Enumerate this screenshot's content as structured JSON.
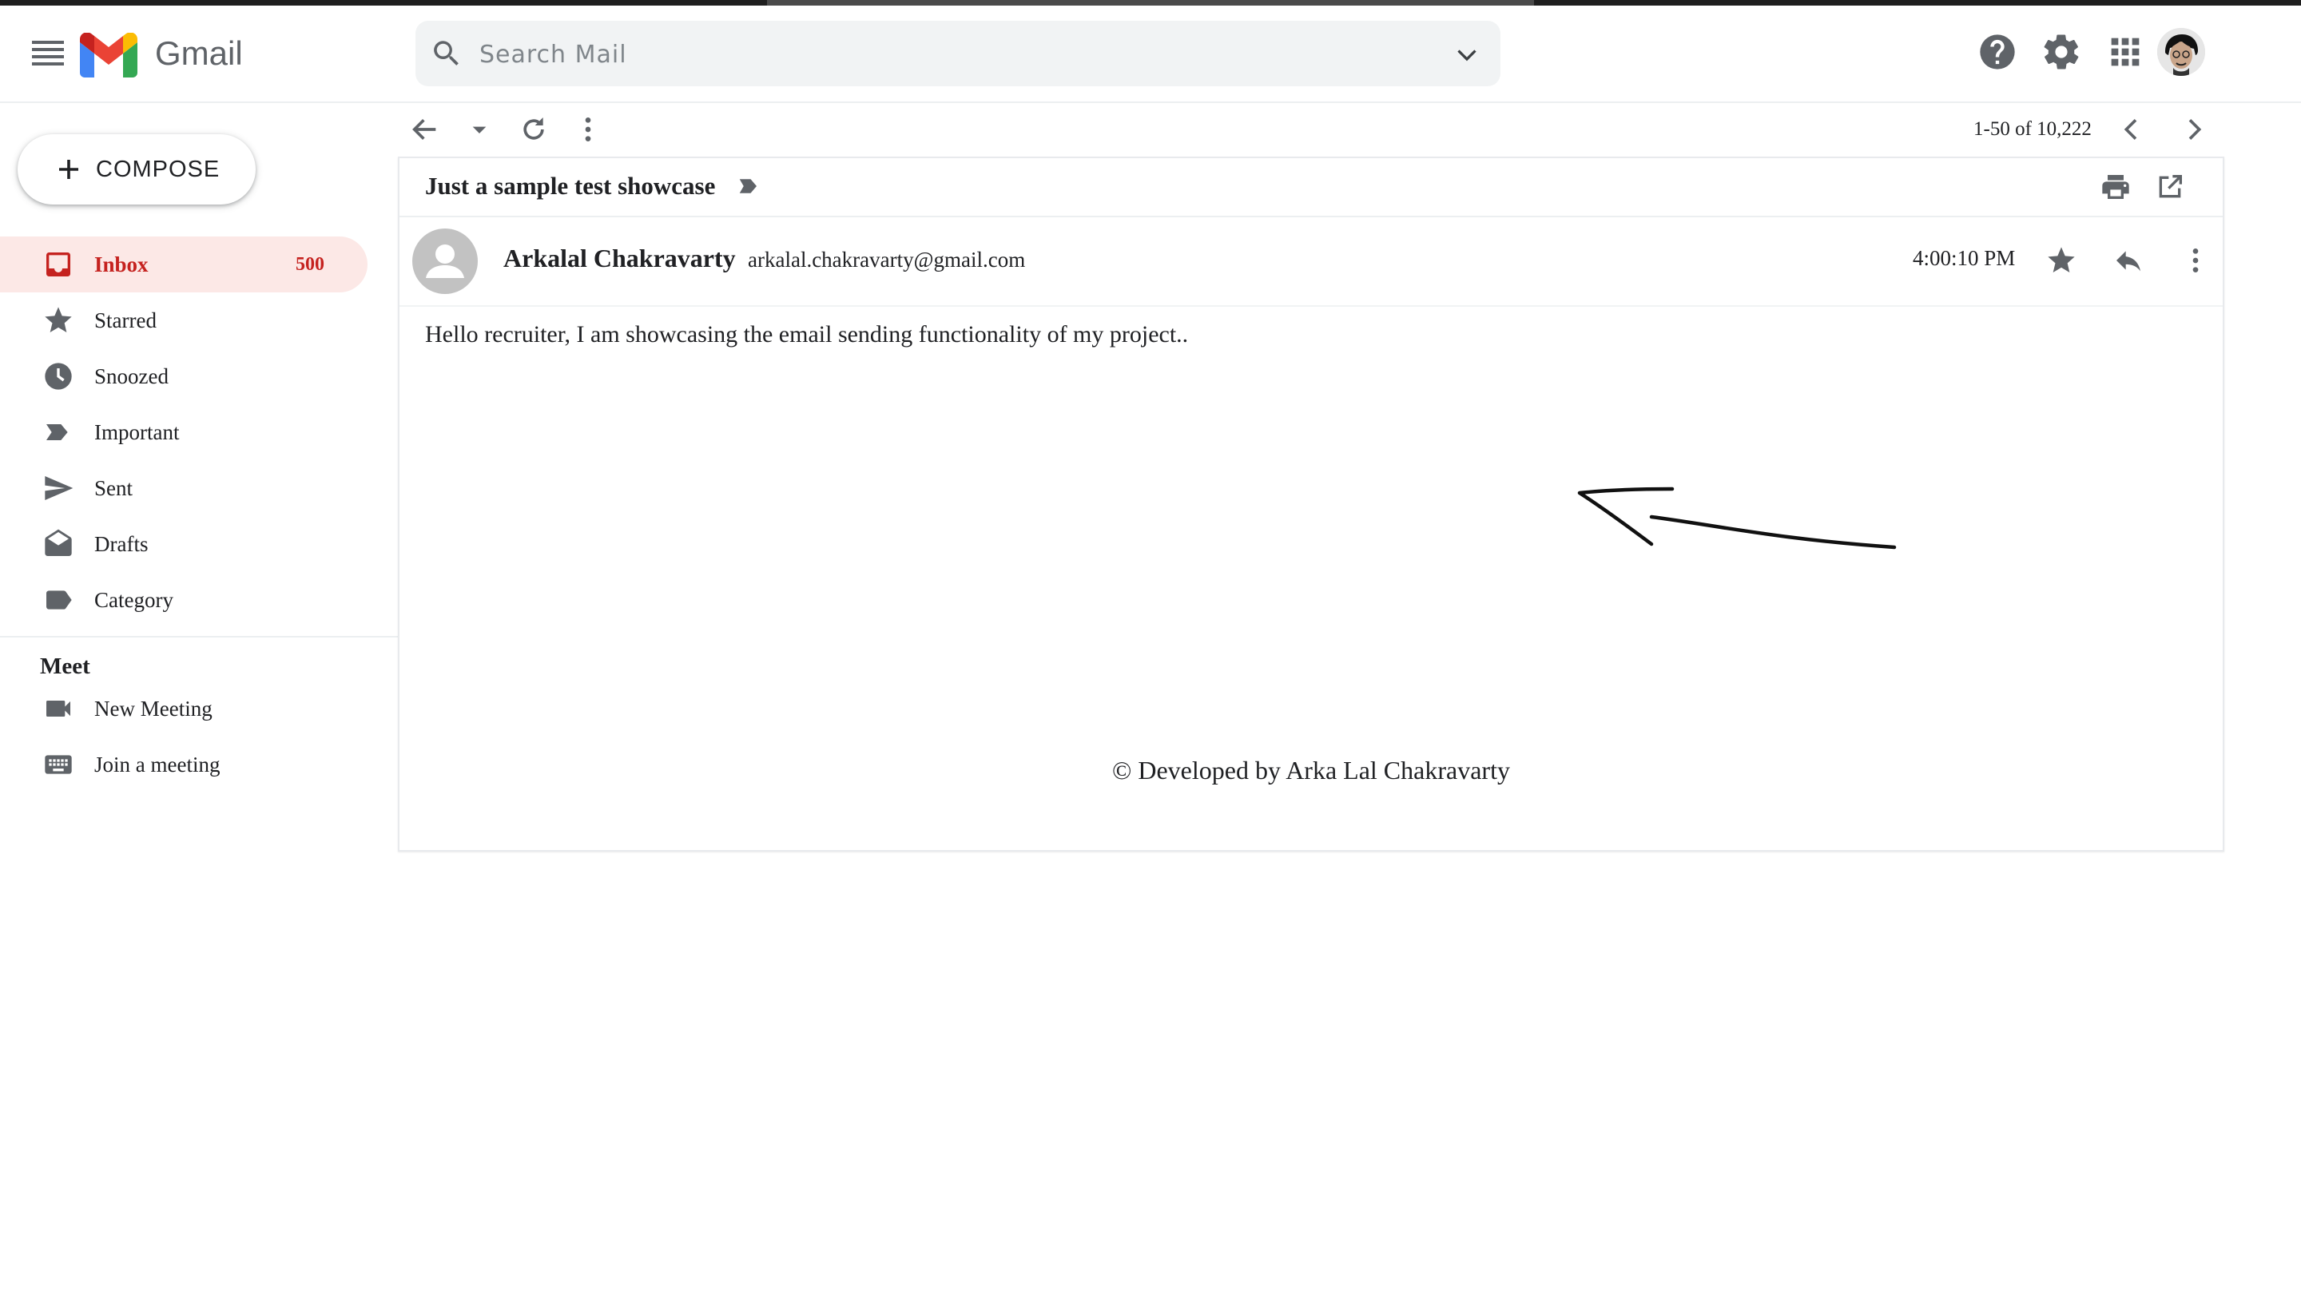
{
  "app": {
    "brand": "Gmail"
  },
  "search": {
    "placeholder": "Search Mail"
  },
  "compose": {
    "label": "COMPOSE"
  },
  "sidebar": {
    "items": [
      {
        "label": "Inbox",
        "icon": "inbox-icon",
        "count": "500",
        "active": true
      },
      {
        "label": "Starred",
        "icon": "star-icon"
      },
      {
        "label": "Snoozed",
        "icon": "clock-icon"
      },
      {
        "label": "Important",
        "icon": "important-icon"
      },
      {
        "label": "Sent",
        "icon": "send-icon"
      },
      {
        "label": "Drafts",
        "icon": "drafts-icon"
      },
      {
        "label": "Category",
        "icon": "label-icon"
      }
    ],
    "meet_title": "Meet",
    "meet_items": [
      {
        "label": "New Meeting",
        "icon": "video-icon"
      },
      {
        "label": "Join a meeting",
        "icon": "keyboard-icon"
      }
    ]
  },
  "toolbar": {
    "pager": "1-50 of 10,222"
  },
  "message": {
    "subject": "Just a sample test showcase",
    "sender_name": "Arkalal Chakravarty",
    "sender_email": "arkalal.chakravarty@gmail.com",
    "time": "4:00:10 PM",
    "body": "Hello recruiter, I am showcasing the email sending functionality of my project..",
    "footer": "© Developed by Arka Lal Chakravarty"
  },
  "colors": {
    "accent_red": "#c5221f",
    "active_bg": "#fce8e6",
    "icon_gray": "#5f6368"
  }
}
